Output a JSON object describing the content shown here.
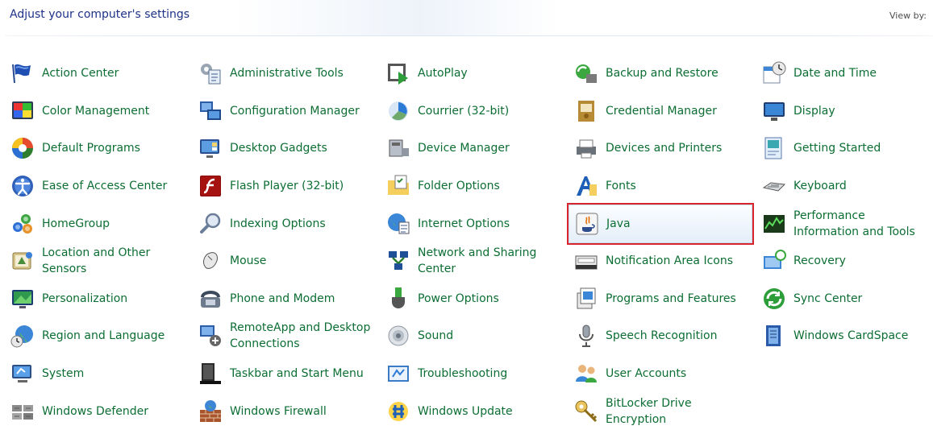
{
  "header": {
    "title": "Adjust your computer's settings",
    "view_by": "View by:"
  },
  "items": [
    {
      "label": "Action Center",
      "icon": "flag-icon"
    },
    {
      "label": "Color Management",
      "icon": "color-management-icon"
    },
    {
      "label": "Default Programs",
      "icon": "default-programs-icon"
    },
    {
      "label": "Ease of Access Center",
      "icon": "ease-of-access-icon"
    },
    {
      "label": "HomeGroup",
      "icon": "homegroup-icon"
    },
    {
      "label": "Location and Other Sensors",
      "icon": "location-sensors-icon"
    },
    {
      "label": "Personalization",
      "icon": "personalization-icon"
    },
    {
      "label": "Region and Language",
      "icon": "globe-clock-icon"
    },
    {
      "label": "System",
      "icon": "system-icon"
    },
    {
      "label": "Windows Defender",
      "icon": "defender-icon"
    },
    {
      "label": "Administrative Tools",
      "icon": "admin-tools-icon"
    },
    {
      "label": "Configuration Manager",
      "icon": "configuration-manager-icon"
    },
    {
      "label": "Desktop Gadgets",
      "icon": "desktop-gadgets-icon"
    },
    {
      "label": "Flash Player (32-bit)",
      "icon": "flash-player-icon"
    },
    {
      "label": "Indexing Options",
      "icon": "magnifier-icon"
    },
    {
      "label": "Mouse",
      "icon": "mouse-icon"
    },
    {
      "label": "Phone and Modem",
      "icon": "phone-icon"
    },
    {
      "label": "RemoteApp and Desktop Connections",
      "icon": "remoteapp-icon"
    },
    {
      "label": "Taskbar and Start Menu",
      "icon": "taskbar-icon"
    },
    {
      "label": "Windows Firewall",
      "icon": "firewall-icon"
    },
    {
      "label": "AutoPlay",
      "icon": "autoplay-icon"
    },
    {
      "label": "Courrier (32-bit)",
      "icon": "courrier-icon"
    },
    {
      "label": "Device Manager",
      "icon": "device-manager-icon"
    },
    {
      "label": "Folder Options",
      "icon": "folder-options-icon"
    },
    {
      "label": "Internet Options",
      "icon": "internet-options-icon"
    },
    {
      "label": "Network and Sharing Center",
      "icon": "network-icon"
    },
    {
      "label": "Power Options",
      "icon": "power-icon"
    },
    {
      "label": "Sound",
      "icon": "speaker-icon"
    },
    {
      "label": "Troubleshooting",
      "icon": "troubleshooting-icon"
    },
    {
      "label": "Windows Update",
      "icon": "windows-update-icon"
    },
    {
      "label": "Backup and Restore",
      "icon": "backup-icon"
    },
    {
      "label": "Credential Manager",
      "icon": "credential-icon"
    },
    {
      "label": "Devices and Printers",
      "icon": "printer-icon"
    },
    {
      "label": "Fonts",
      "icon": "fonts-icon"
    },
    {
      "label": "Java",
      "icon": "java-icon",
      "selected": true
    },
    {
      "label": "Notification Area Icons",
      "icon": "notification-icon"
    },
    {
      "label": "Programs and Features",
      "icon": "programs-icon"
    },
    {
      "label": "Speech Recognition",
      "icon": "microphone-icon"
    },
    {
      "label": "User Accounts",
      "icon": "users-icon"
    },
    {
      "label": "BitLocker Drive Encryption",
      "icon": "key-icon"
    },
    {
      "label": "Date and Time",
      "icon": "calendar-clock-icon"
    },
    {
      "label": "Display",
      "icon": "monitor-icon"
    },
    {
      "label": "Getting Started",
      "icon": "getting-started-icon"
    },
    {
      "label": "Keyboard",
      "icon": "keyboard-icon"
    },
    {
      "label": "Performance Information and Tools",
      "icon": "performance-icon"
    },
    {
      "label": "Recovery",
      "icon": "recovery-icon"
    },
    {
      "label": "Sync Center",
      "icon": "sync-icon"
    },
    {
      "label": "Windows CardSpace",
      "icon": "cardspace-icon"
    }
  ]
}
